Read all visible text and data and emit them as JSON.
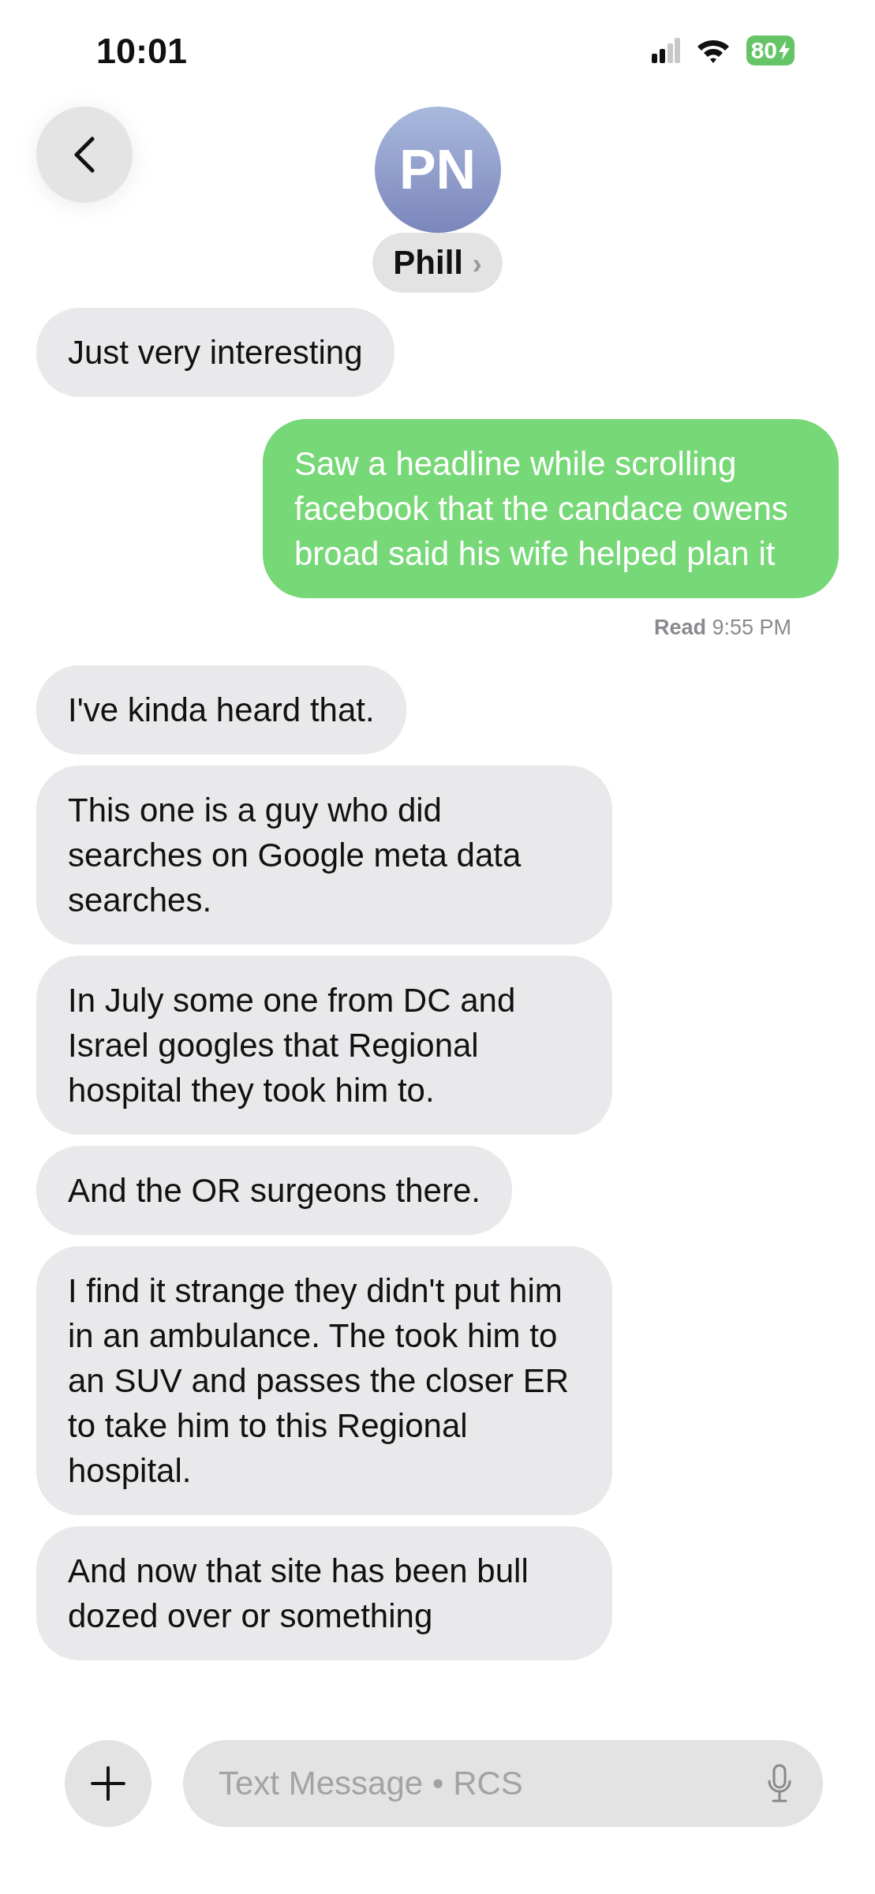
{
  "status_bar": {
    "time": "10:01",
    "battery": "80"
  },
  "header": {
    "initials": "PN",
    "name": "Phill",
    "chevron": "›"
  },
  "messages": [
    {
      "kind": "received",
      "text": "Just very interesting"
    },
    {
      "kind": "sent",
      "text": "Saw a headline while scrolling facebook that the candace owens broad said his wife helped plan it"
    },
    {
      "kind": "receipt",
      "label": "Read",
      "time": "9:55 PM"
    },
    {
      "kind": "received",
      "text": "I've kinda heard that."
    },
    {
      "kind": "received",
      "text": "This one is a guy who did searches on Google meta data searches."
    },
    {
      "kind": "received",
      "text": "In July some one from DC and Israel  googles that Regional hospital they took him to."
    },
    {
      "kind": "received",
      "text": "And the OR surgeons there."
    },
    {
      "kind": "received",
      "text": "I find it strange they didn't put him in an ambulance. The took him to an SUV and passes the closer ER to take him to this Regional hospital."
    },
    {
      "kind": "received",
      "text": "And now that site has been bull dozed over or something"
    }
  ],
  "composer": {
    "placeholder": "Text Message • RCS"
  }
}
